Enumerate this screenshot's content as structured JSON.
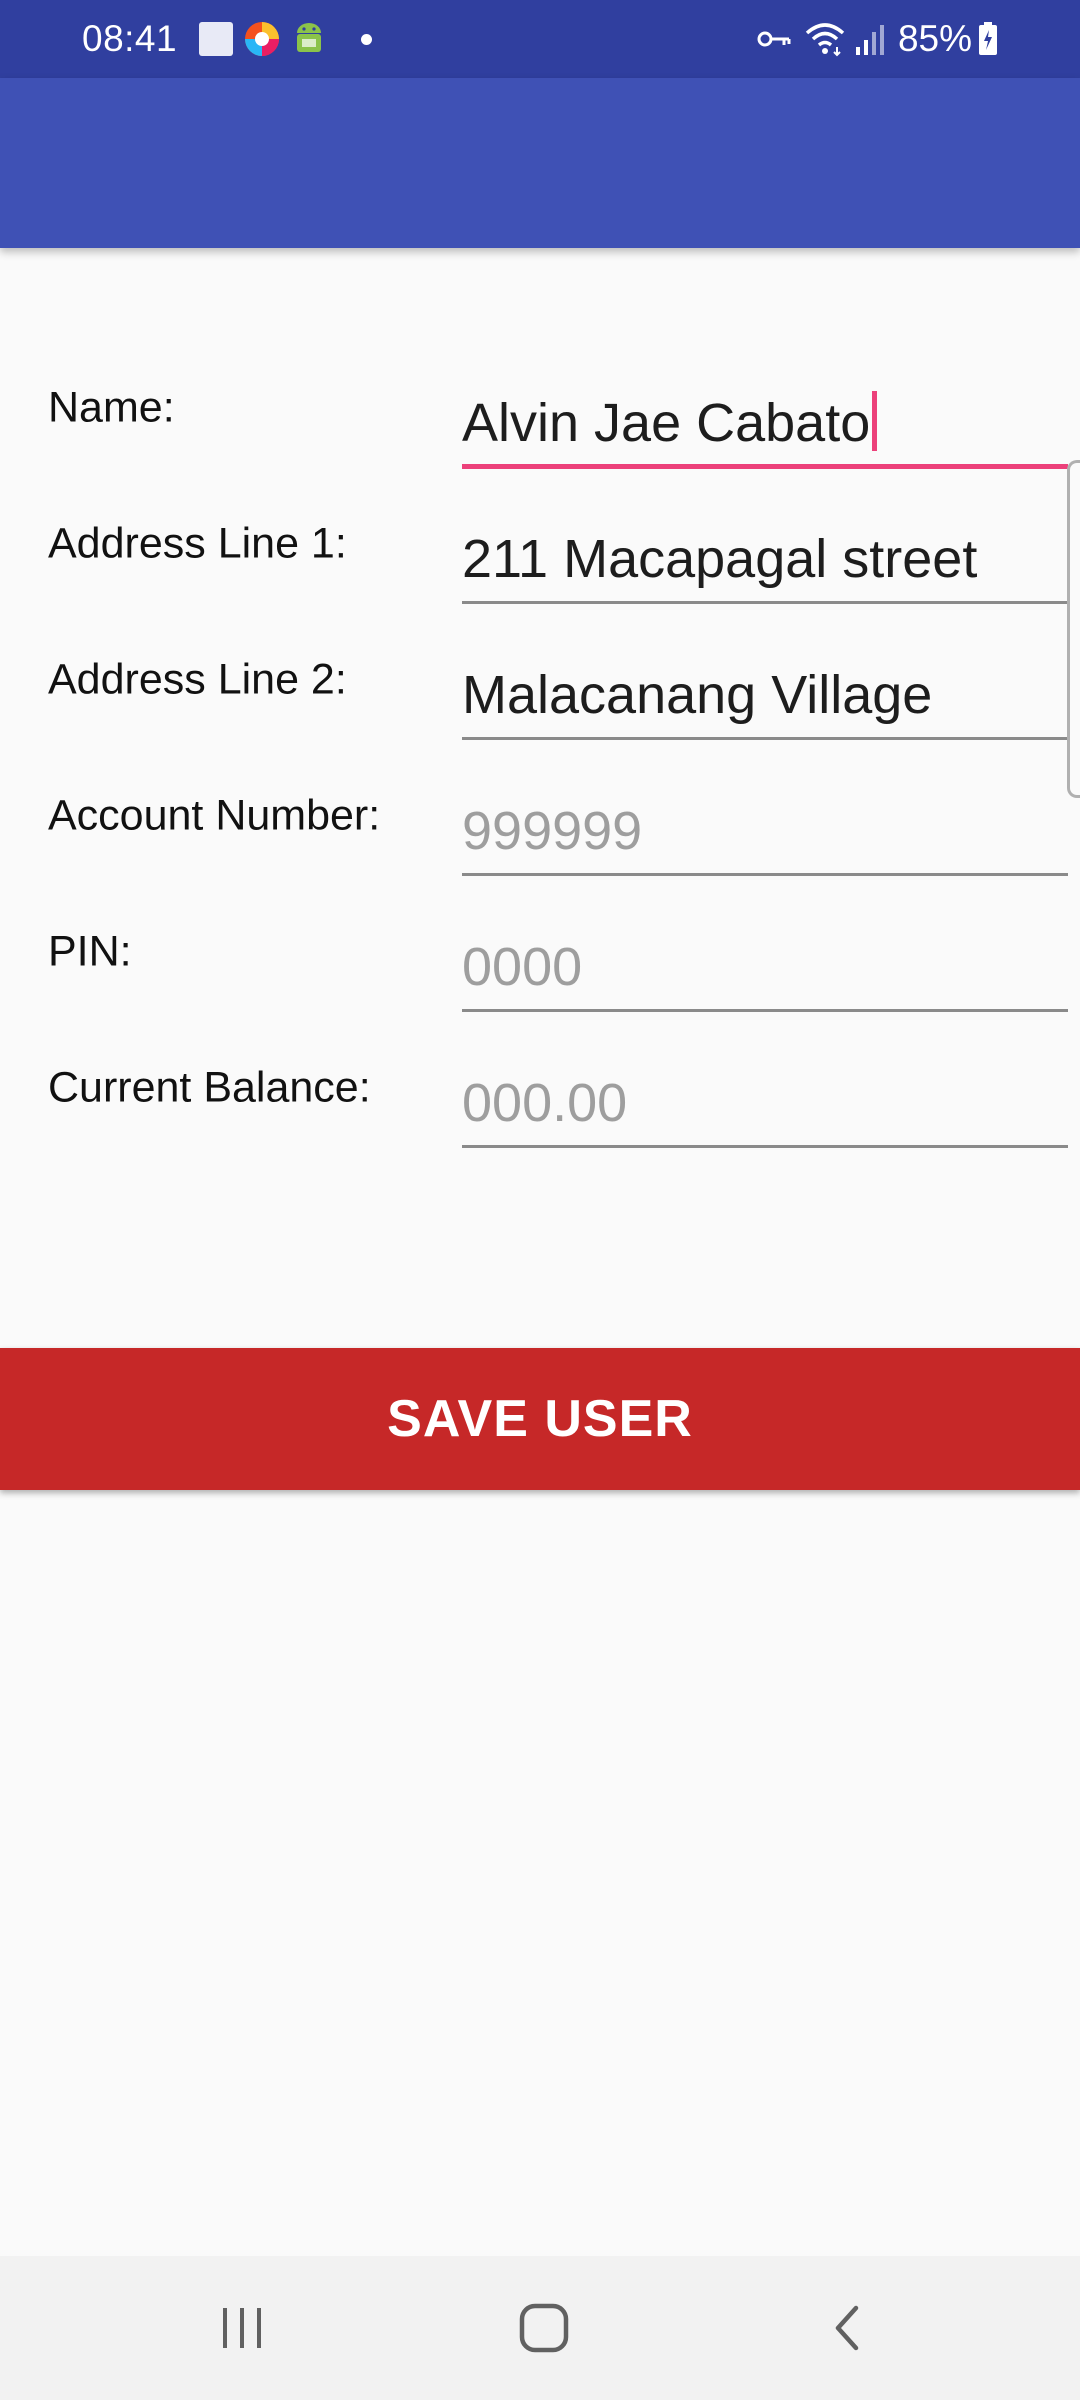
{
  "status_bar": {
    "time": "08:41",
    "battery": "85%"
  },
  "form": {
    "fields": [
      {
        "label": "Name:",
        "value": "Alvin Jae Cabato",
        "placeholder": ""
      },
      {
        "label": "Address Line 1:",
        "value": "211 Macapagal street",
        "placeholder": ""
      },
      {
        "label": "Address Line 2:",
        "value": "Malacanang Village",
        "placeholder": ""
      },
      {
        "label": "Account Number:",
        "value": "",
        "placeholder": "999999"
      },
      {
        "label": "PIN:",
        "value": "",
        "placeholder": "0000"
      },
      {
        "label": "Current Balance:",
        "value": "",
        "placeholder": "000.00"
      }
    ],
    "save_label": "SAVE USER"
  },
  "colors": {
    "status_bar": "#303f9f",
    "app_bar": "#3f51b5",
    "accent": "#ec407a",
    "save_button": "#c62828"
  },
  "icons": {
    "status_left": [
      "square-notification-icon",
      "colorful-app-icon",
      "android-debug-icon",
      "dot-icon"
    ],
    "status_right": [
      "vpn-key-icon",
      "wifi-icon",
      "signal-icon",
      "battery-charging-icon"
    ],
    "nav": [
      "recents-icon",
      "home-icon",
      "back-icon"
    ]
  }
}
